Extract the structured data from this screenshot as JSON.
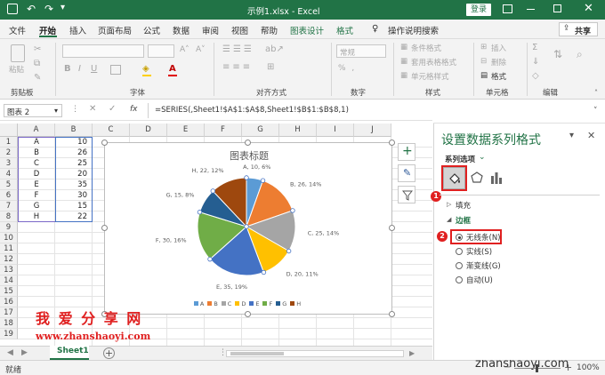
{
  "titlebar": {
    "filename": "示例1.xlsx",
    "separator": "-",
    "app": "Excel",
    "login": "登录"
  },
  "menu": {
    "tabs": [
      "文件",
      "开始",
      "插入",
      "页面布局",
      "公式",
      "数据",
      "审阅",
      "视图",
      "帮助",
      "图表设计",
      "格式"
    ],
    "active": "开始",
    "tellme": "操作说明搜索",
    "share": "共享"
  },
  "ribbon": {
    "groups": {
      "clipboard": "剪贴板",
      "font": "字体",
      "align": "对齐方式",
      "number": "数字",
      "styles": "样式",
      "cells": "单元格",
      "edit": "编辑"
    },
    "paste": "粘贴",
    "number_format": "常规",
    "cond_format": "条件格式",
    "table_format": "套用表格格式",
    "cell_style": "单元格样式",
    "insert": "插入",
    "delete": "删除",
    "format": "格式"
  },
  "formula_bar": {
    "name_box": "图表 2",
    "fx": "fx",
    "formula": "=SERIES(,Sheet1!$A$1:$A$8,Sheet1!$B$1:$B$8,1)"
  },
  "grid": {
    "columns": [
      "A",
      "B",
      "C",
      "D",
      "E",
      "F",
      "G",
      "H",
      "I",
      "J"
    ],
    "rows": [
      "1",
      "2",
      "3",
      "4",
      "5",
      "6",
      "7",
      "8",
      "9",
      "10",
      "11",
      "12",
      "13",
      "14",
      "15",
      "16",
      "17",
      "18",
      "19"
    ],
    "data": [
      [
        "A",
        "10"
      ],
      [
        "B",
        "26"
      ],
      [
        "C",
        "25"
      ],
      [
        "D",
        "20"
      ],
      [
        "E",
        "35"
      ],
      [
        "F",
        "30"
      ],
      [
        "G",
        "15"
      ],
      [
        "H",
        "22"
      ]
    ]
  },
  "chart": {
    "title": "图表标题",
    "data_labels": [
      "A, 10, 6%",
      "B, 26, 14%",
      "C, 25, 14%",
      "D, 20, 11%",
      "E, 35, 19%",
      "F, 30, 16%",
      "G, 15, 8%",
      "H, 22, 12%"
    ],
    "colors": [
      "#5B9BD5",
      "#ED7D31",
      "#A5A5A5",
      "#FFC000",
      "#4472C4",
      "#70AD47",
      "#255E91",
      "#9E480E"
    ]
  },
  "chart_data": {
    "type": "pie",
    "title": "图表标题",
    "categories": [
      "A",
      "B",
      "C",
      "D",
      "E",
      "F",
      "G",
      "H"
    ],
    "values": [
      10,
      26,
      25,
      20,
      35,
      30,
      15,
      22
    ],
    "percent_labels": [
      "6%",
      "14%",
      "14%",
      "11%",
      "19%",
      "16%",
      "8%",
      "12%"
    ],
    "legend": "bottom"
  },
  "pane": {
    "title": "设置数据系列格式",
    "options": "系列选项",
    "fill": "填充",
    "border": "边框",
    "radios": [
      "无线条(N)",
      "实线(S)",
      "渐变线(G)",
      "自动(U)"
    ],
    "badge1": "1",
    "badge2": "2"
  },
  "watermark": {
    "title": "我 爱 分 享 网",
    "url": "www.zhanshaoyi.com",
    "corner": "zhanshaoyi.com"
  },
  "sheet": {
    "tab": "Sheet1"
  },
  "status": {
    "ready": "就绪",
    "zoom": "100%"
  }
}
